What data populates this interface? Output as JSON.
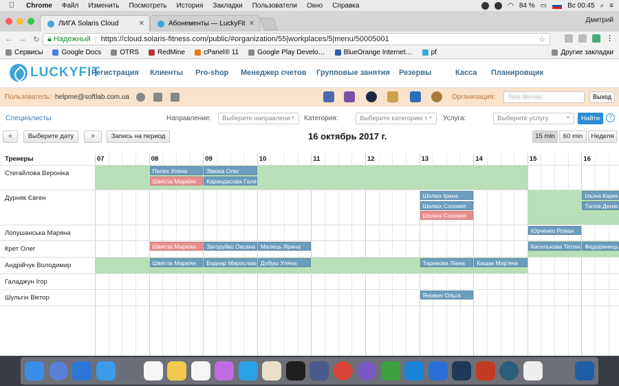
{
  "menubar": {
    "app": "Chrome",
    "items": [
      "Файл",
      "Изменить",
      "Посмотреть",
      "История",
      "Закладки",
      "Пользователи",
      "Окно",
      "Справка"
    ],
    "battery": "84 %",
    "clock": "Вс 00:45"
  },
  "browser": {
    "tabs": [
      {
        "title": "ЛИГА Solaris Cloud",
        "active": true
      },
      {
        "title": "Абонементы — LuckyFit",
        "active": false
      }
    ],
    "user": "Дмитрий",
    "secure_label": "Надежный",
    "url": "https://cloud.solaris-fitness.com/public/#organization/55|workplaces/5|menu/50005001",
    "bookmarks": [
      "Сервисы",
      "Google Docs",
      "OTRS",
      "RedMine",
      "cPanel® 11",
      "Google Play Develo…",
      "BlueOrange Internet…",
      "pf"
    ],
    "other_bookmarks": "Другие закладки"
  },
  "app": {
    "logo": "LUCKYFIT",
    "nav": [
      "Регистрация",
      "Клиенты",
      "Pro-shop",
      "Менеджер счетов",
      "Групповые занятия",
      "Резервы",
      "Касса",
      "Планировщик"
    ],
    "user_label": "Пользователь:",
    "user_email": "helpme@softlab.com.ua",
    "org_label": "Организация:",
    "org_value": "Лига Фитнес",
    "exit": "Выход"
  },
  "filters": {
    "specialists": "Специалисты",
    "direction_label": "Направление:",
    "direction_ph": "Выберите направлени",
    "category_label": "Категория:",
    "category_ph": "Выберите категорию т",
    "service_label": "Услуга:",
    "service_ph": "Выберите услугу",
    "find": "Найти",
    "help": "?"
  },
  "toolbar": {
    "prev": "<",
    "pick_date": "Выберите дату",
    "next": ">",
    "record_period": "Запись на период",
    "date": "16 октябрь 2017 г.",
    "views": [
      "15 min",
      "60 min",
      "Неделя"
    ],
    "active_view": "15 min"
  },
  "schedule": {
    "header_label": "Тренеры",
    "hours": [
      "07",
      "08",
      "09",
      "10",
      "11",
      "12",
      "13",
      "14",
      "15",
      "16"
    ],
    "trainers": [
      {
        "name": "Стегайлова Вероніка",
        "green": [
          [
            "07:00",
            "15:00"
          ]
        ],
        "events": [
          {
            "t": "Пелех Уляна",
            "s": "08:00",
            "e": "09:00",
            "c": "b",
            "l": 0
          },
          {
            "t": "Зімока Олег",
            "s": "09:00",
            "e": "10:00",
            "c": "b",
            "l": 0
          },
          {
            "t": "Швягла Маркіян",
            "s": "08:00",
            "e": "09:00",
            "c": "r",
            "l": 1
          },
          {
            "t": "Карандасова Галина",
            "s": "09:00",
            "e": "10:00",
            "c": "b",
            "l": 1
          }
        ]
      },
      {
        "name": "Дурняк Євген",
        "green": [
          [
            "15:00",
            "17:00"
          ]
        ],
        "events": [
          {
            "t": "Шелюх Ірина",
            "s": "13:00",
            "e": "14:00",
            "c": "b",
            "l": 0
          },
          {
            "t": "Шелюх Соломія",
            "s": "13:00",
            "e": "14:00",
            "c": "b",
            "l": 1
          },
          {
            "t": "Шелюх Соломія",
            "s": "13:00",
            "e": "14:00",
            "c": "r",
            "l": 2
          },
          {
            "t": "Ільїна Карина",
            "s": "16:00",
            "e": "17:00",
            "c": "b",
            "l": 0
          },
          {
            "t": "Тагієв Денис",
            "s": "16:00",
            "e": "17:00",
            "c": "b",
            "l": 1
          }
        ]
      },
      {
        "name": "Лопушанська Маряна",
        "green": [],
        "events": [
          {
            "t": "Юрченко Роман",
            "s": "15:00",
            "e": "16:00",
            "c": "b",
            "l": 0
          }
        ]
      },
      {
        "name": "Крет Олег",
        "green": [
          [
            "15:00",
            "17:00"
          ]
        ],
        "events": [
          {
            "t": "Швягла Маркіян",
            "s": "08:00",
            "e": "09:00",
            "c": "r",
            "l": 0
          },
          {
            "t": "Загоруйко Оксана",
            "s": "09:00",
            "e": "10:00",
            "c": "b",
            "l": 0
          },
          {
            "t": "Малець Ярина",
            "s": "10:00",
            "e": "11:00",
            "c": "b",
            "l": 0
          },
          {
            "t": "Киселькова Тетяна",
            "s": "15:00",
            "e": "16:00",
            "c": "b",
            "l": 0
          },
          {
            "t": "Федоринець",
            "s": "16:00",
            "e": "17:00",
            "c": "b",
            "l": 0
          }
        ]
      },
      {
        "name": "Андрійчук Володимир",
        "green": [
          [
            "07:00",
            "15:00"
          ]
        ],
        "events": [
          {
            "t": "Швягла Маркіян",
            "s": "08:00",
            "e": "09:00",
            "c": "b",
            "l": 0
          },
          {
            "t": "Боднар Мирослава",
            "s": "09:00",
            "e": "10:00",
            "c": "b",
            "l": 0
          },
          {
            "t": "Добуш Уляна",
            "s": "10:00",
            "e": "11:00",
            "c": "b",
            "l": 0
          },
          {
            "t": "Тарнвова Ліана",
            "s": "13:00",
            "e": "14:00",
            "c": "b",
            "l": 0
          },
          {
            "t": "Кащак Мар'яна",
            "s": "14:00",
            "e": "15:00",
            "c": "b",
            "l": 0
          }
        ]
      },
      {
        "name": "Галаджун Ігор",
        "green": [],
        "events": []
      },
      {
        "name": "Шульгін Віктор",
        "green": [],
        "events": [
          {
            "t": "Янович Ольга",
            "s": "13:00",
            "e": "14:00",
            "c": "b",
            "l": 0
          }
        ]
      }
    ]
  },
  "colors": {
    "brand": "#3aa6d6",
    "nav": "#3d6b8c",
    "green": "#b9dfb9",
    "event_blue": "#6c9dbd",
    "event_red": "#e88e8e",
    "orgbar": "#fae3cc"
  }
}
